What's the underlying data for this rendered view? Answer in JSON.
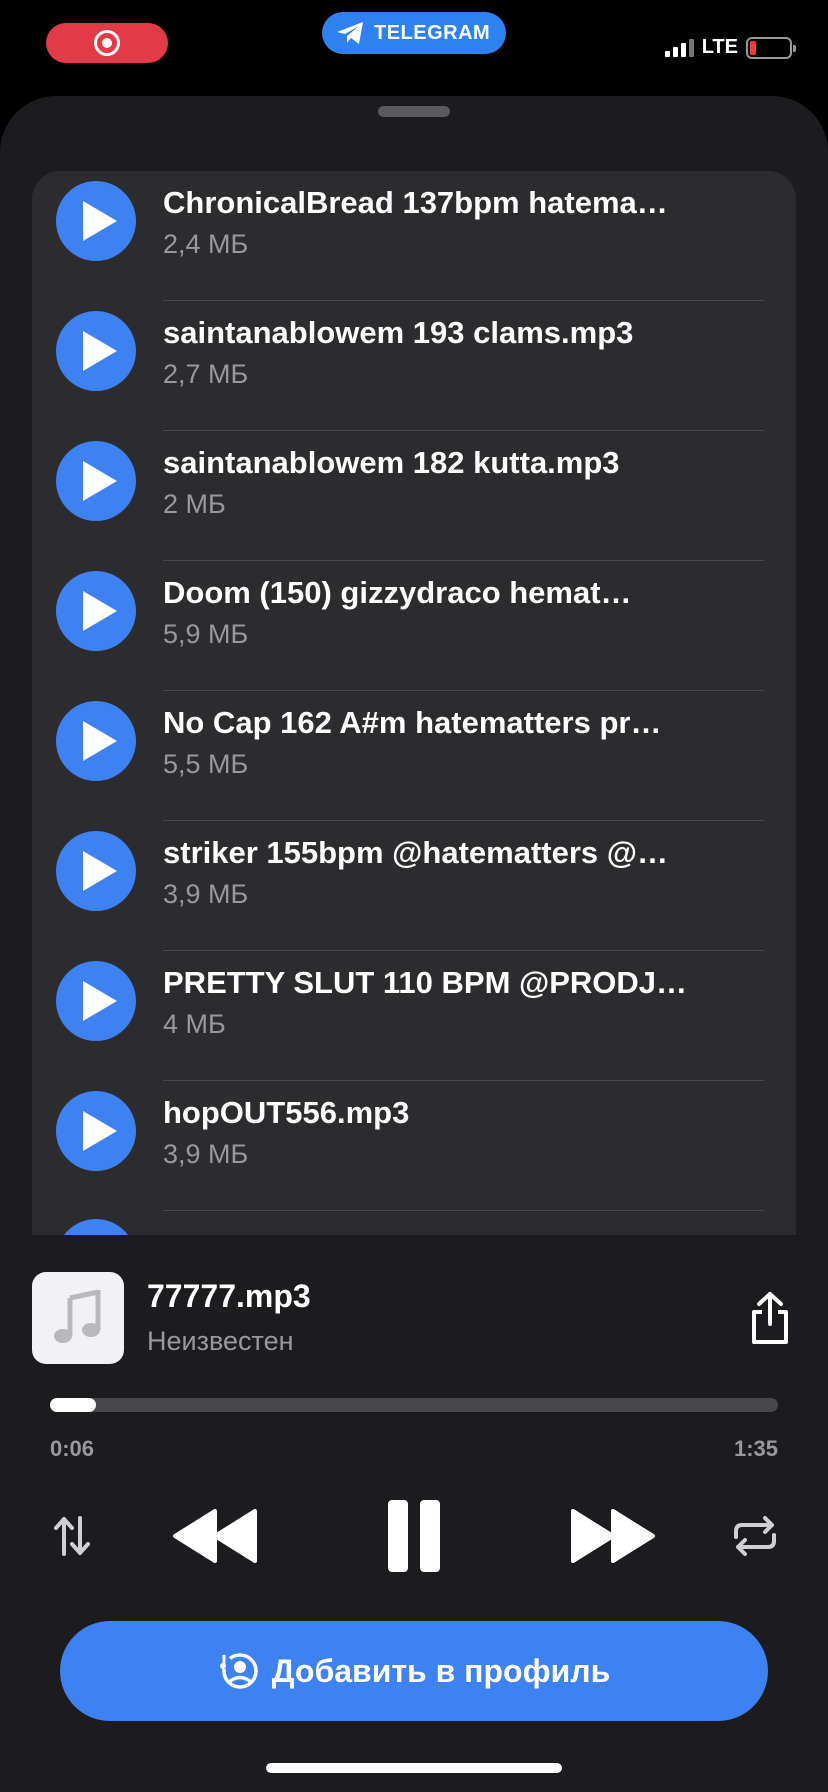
{
  "status_bar": {
    "app_pill_label": "TELEGRAM",
    "network": "LTE"
  },
  "tracks": [
    {
      "title": "ChronicalBread 137bpm hatema…",
      "size": "2,4 МБ"
    },
    {
      "title": "saintanablowem 193 clams.mp3",
      "size": "2,7 МБ"
    },
    {
      "title": "saintanablowem 182 kutta.mp3",
      "size": "2 МБ"
    },
    {
      "title": "Doom (150) gizzydraco hemat…",
      "size": "5,9 МБ"
    },
    {
      "title": "No Cap 162 A#m hatematters pr…",
      "size": "5,5 МБ"
    },
    {
      "title": "striker 155bpm @hatematters @…",
      "size": "3,9 МБ"
    },
    {
      "title": "PRETTY SLUT 110 BPM @PRODJ…",
      "size": "4 МБ"
    },
    {
      "title": "hopOUT556.mp3",
      "size": "3,9 МБ"
    }
  ],
  "now_playing": {
    "title": "77777.mp3",
    "artist": "Неизвестен",
    "elapsed": "0:06",
    "total": "1:35",
    "progress": 0.063
  },
  "add_to_profile_label": "Добавить в профиль",
  "colors": {
    "accent": "#3e82f1",
    "record": "#e23a47",
    "sheet_bg": "#1c1c1e",
    "card_bg": "#2c2c2e"
  }
}
